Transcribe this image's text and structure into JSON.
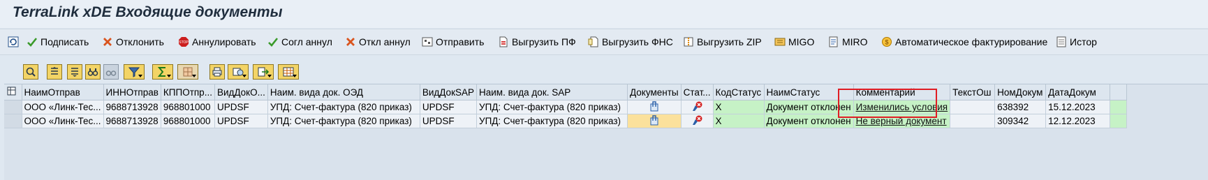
{
  "window": {
    "title": "TerraLink xDE Входящие документы"
  },
  "toolbar": {
    "refresh_icon": "refresh-icon",
    "buttons": [
      {
        "label": "Подписать",
        "icon": "check-icon",
        "color": "#3a9a2a"
      },
      {
        "label": "Отклонить",
        "icon": "cross-icon",
        "color": "#d9541e"
      },
      {
        "label": "Аннулировать",
        "icon": "stop-icon",
        "color": "#cc1f1f"
      },
      {
        "label": "Согл аннул",
        "icon": "check-icon",
        "color": "#3a9a2a"
      },
      {
        "label": "Откл аннул",
        "icon": "cross-icon",
        "color": "#d9541e"
      },
      {
        "label": "Отправить",
        "icon": "send-icon"
      },
      {
        "label": "Выгрузить ПФ",
        "icon": "pdf-export-icon"
      },
      {
        "label": "Выгрузить ФНС",
        "icon": "document-export-icon"
      },
      {
        "label": "Выгрузить ZIP",
        "icon": "zip-icon"
      },
      {
        "label": "MIGO",
        "icon": "migo-icon"
      },
      {
        "label": "MIRO",
        "icon": "miro-icon"
      },
      {
        "label": "Автоматическое фактурирование",
        "icon": "auto-invoice-icon"
      },
      {
        "label": "Истор",
        "icon": "history-icon"
      }
    ]
  },
  "grid": {
    "columns": [
      "НаимОтправ",
      "ИННОтправ",
      "КППОтпр...",
      "ВидДокО...",
      "Наим. вида док. ОЭД",
      "ВидДокSAP",
      "Наим. вида док. SAP",
      "Документы",
      "Стат...",
      "КодСтатус",
      "НаимСтатус",
      "Комментарий",
      "ТекстОш",
      "НомДокум",
      "ДатаДокум",
      ""
    ],
    "rows": [
      [
        "ООО «Линк-Тес...",
        "9688713928",
        "968801000",
        "UPDSF",
        "УПД: Счет-фактура (820 приказ)",
        "UPDSF",
        "УПД: Счет-фактура (820 приказ)",
        "",
        "",
        "X",
        "Документ отклонен",
        "Изменились условия",
        "",
        "638392",
        "15.12.2023",
        ""
      ],
      [
        "ООО «Линк-Тес...",
        "9688713928",
        "968801000",
        "UPDSF",
        "УПД: Счет-фактура (820 приказ)",
        "UPDSF",
        "УПД: Счет-фактура (820 приказ)",
        "",
        "",
        "X",
        "Документ отклонен",
        "Не верный документ",
        "",
        "309342",
        "12.12.2023",
        ""
      ]
    ],
    "status_color": "#c6f2c6",
    "highlight_color": "#e01d24"
  }
}
